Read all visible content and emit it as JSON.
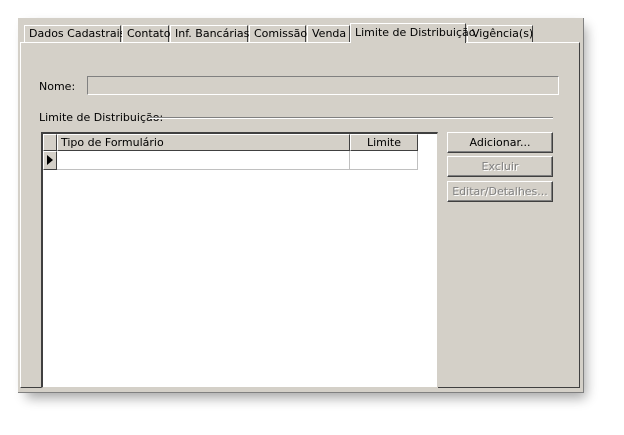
{
  "tabs": [
    {
      "label": "Dados Cadastrais",
      "active": false
    },
    {
      "label": "Contato",
      "active": false
    },
    {
      "label": "Inf. Bancárias",
      "active": false
    },
    {
      "label": "Comissão",
      "active": false
    },
    {
      "label": "Venda",
      "active": false
    },
    {
      "label": "Limite de Distribuição",
      "active": true
    },
    {
      "label": "Vigência(s)",
      "active": false
    }
  ],
  "form": {
    "nome_label": "Nome:",
    "nome_value": ""
  },
  "limite_group": {
    "title": "Limite de Distribuição:"
  },
  "grid": {
    "columns": [
      "Tipo de Formulário",
      "Limite"
    ],
    "rows": [
      {
        "tipo": "",
        "limite": "",
        "current": true
      }
    ]
  },
  "buttons": {
    "add": {
      "label": "Adicionar...",
      "enabled": true
    },
    "delete": {
      "label": "Excluir",
      "enabled": false
    },
    "edit": {
      "label": "Editar/Detalhes...",
      "enabled": false
    }
  }
}
